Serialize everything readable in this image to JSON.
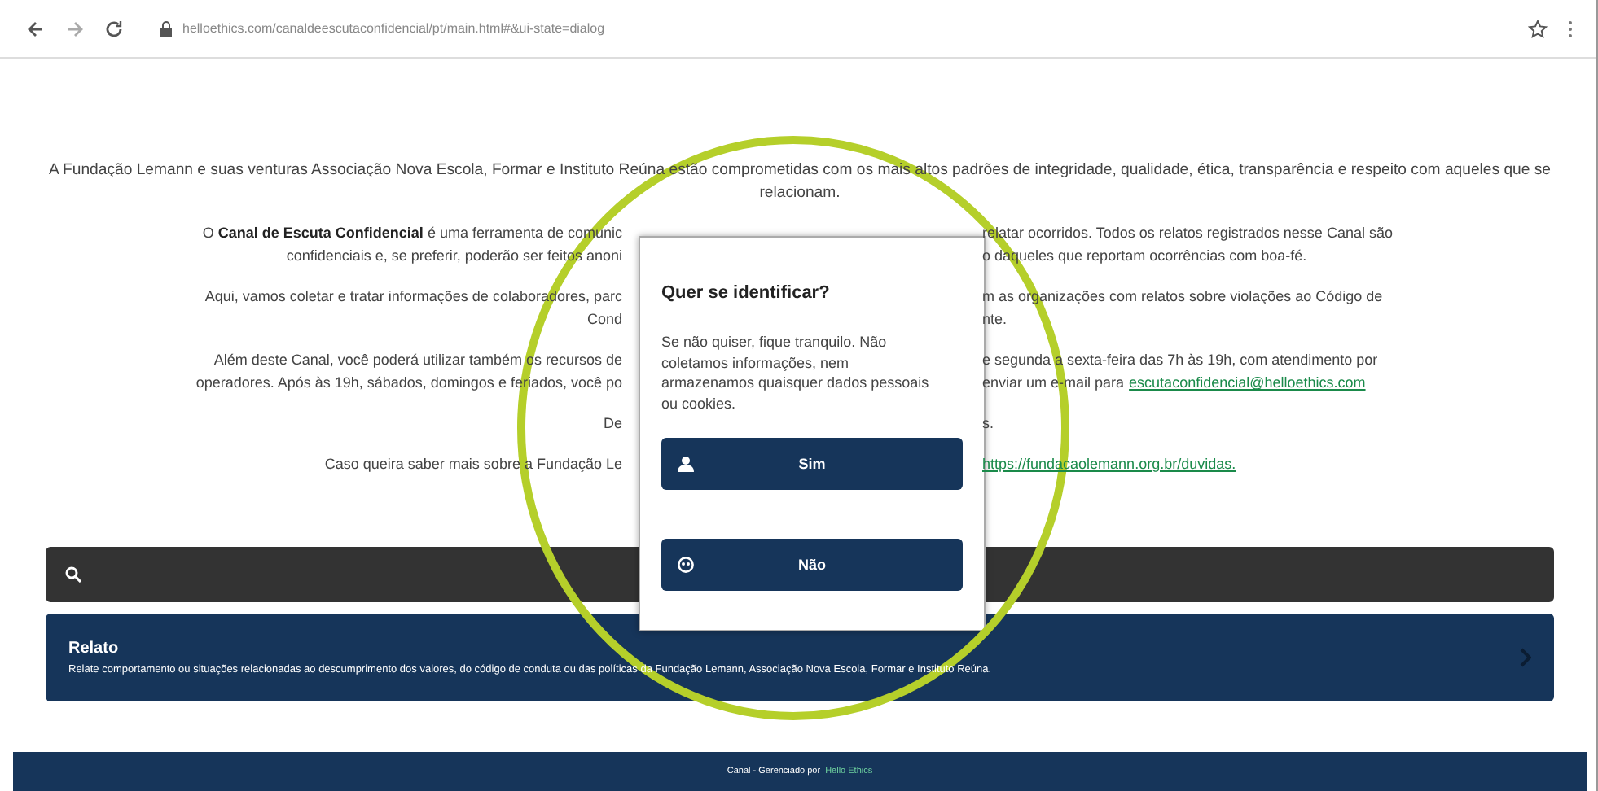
{
  "browser": {
    "url": "helloethics.com/canaldeescutaconfidencial/pt/main.html#&ui-state=dialog"
  },
  "intro": "A Fundação Lemann e suas venturas Associação Nova Escola, Formar e Instituto Reúna estão comprometidas com os mais altos padrões de integridade, qualidade, ética, transparência e respeito com aqueles que se relacionam.",
  "paragraphs": [
    {
      "left": [
        "O **Canal de Escuta Confidencial** é uma ferramenta de comunic",
        "confidenciais e, se preferir, poderão ser feitos anoni"
      ],
      "right": [
        {
          "text": "relatar ocorridos. Todos os relatos registrados nesse Canal são"
        },
        {
          "text": "o daqueles que reportam ocorrências com boa-fé."
        }
      ]
    },
    {
      "left": [
        "Aqui, vamos coletar e tratar informações de colaboradores, parc",
        "Cond"
      ],
      "right": [
        {
          "text": "m as organizações com relatos sobre violações ao Código de"
        },
        {
          "text": "nte."
        }
      ]
    },
    {
      "left": [
        "Além deste Canal, você poderá utilizar também os recursos de",
        "operadores. Após às 19h, sábados, domingos e feriados, você po"
      ],
      "right": [
        {
          "text": "e segunda a sexta-feira das 7h às 19h, com atendimento por"
        },
        {
          "text": "enviar um e-mail para",
          "link": "escutaconfidencial@helloethics.com"
        }
      ]
    },
    {
      "left": [
        "De"
      ],
      "right": [
        {
          "text": "s."
        }
      ]
    },
    {
      "left": [
        "Caso queira saber mais sobre a Fundação Le"
      ],
      "right": [
        {
          "link": "https://fundacaolemann.org.br/duvidas."
        }
      ]
    }
  ],
  "dialog": {
    "title": "Quer se identificar?",
    "body": "Se não quiser, fique tranquilo. Não coletamos informações, nem armazenamos quaisquer dados pessoais ou cookies.",
    "buttons": [
      {
        "kind": "identified",
        "label": "Sim"
      },
      {
        "kind": "anonymous",
        "label": "Não"
      }
    ]
  },
  "card": {
    "title": "Relato",
    "description": "Relate comportamento ou situações relacionadas ao descumprimento dos valores, do código de conduta ou das políticas da Fundação Lemann, Associação Nova Escola, Formar e Instituto Reúna."
  },
  "footer": {
    "text": "Canal - Gerenciado por",
    "link": "Hello Ethics"
  }
}
